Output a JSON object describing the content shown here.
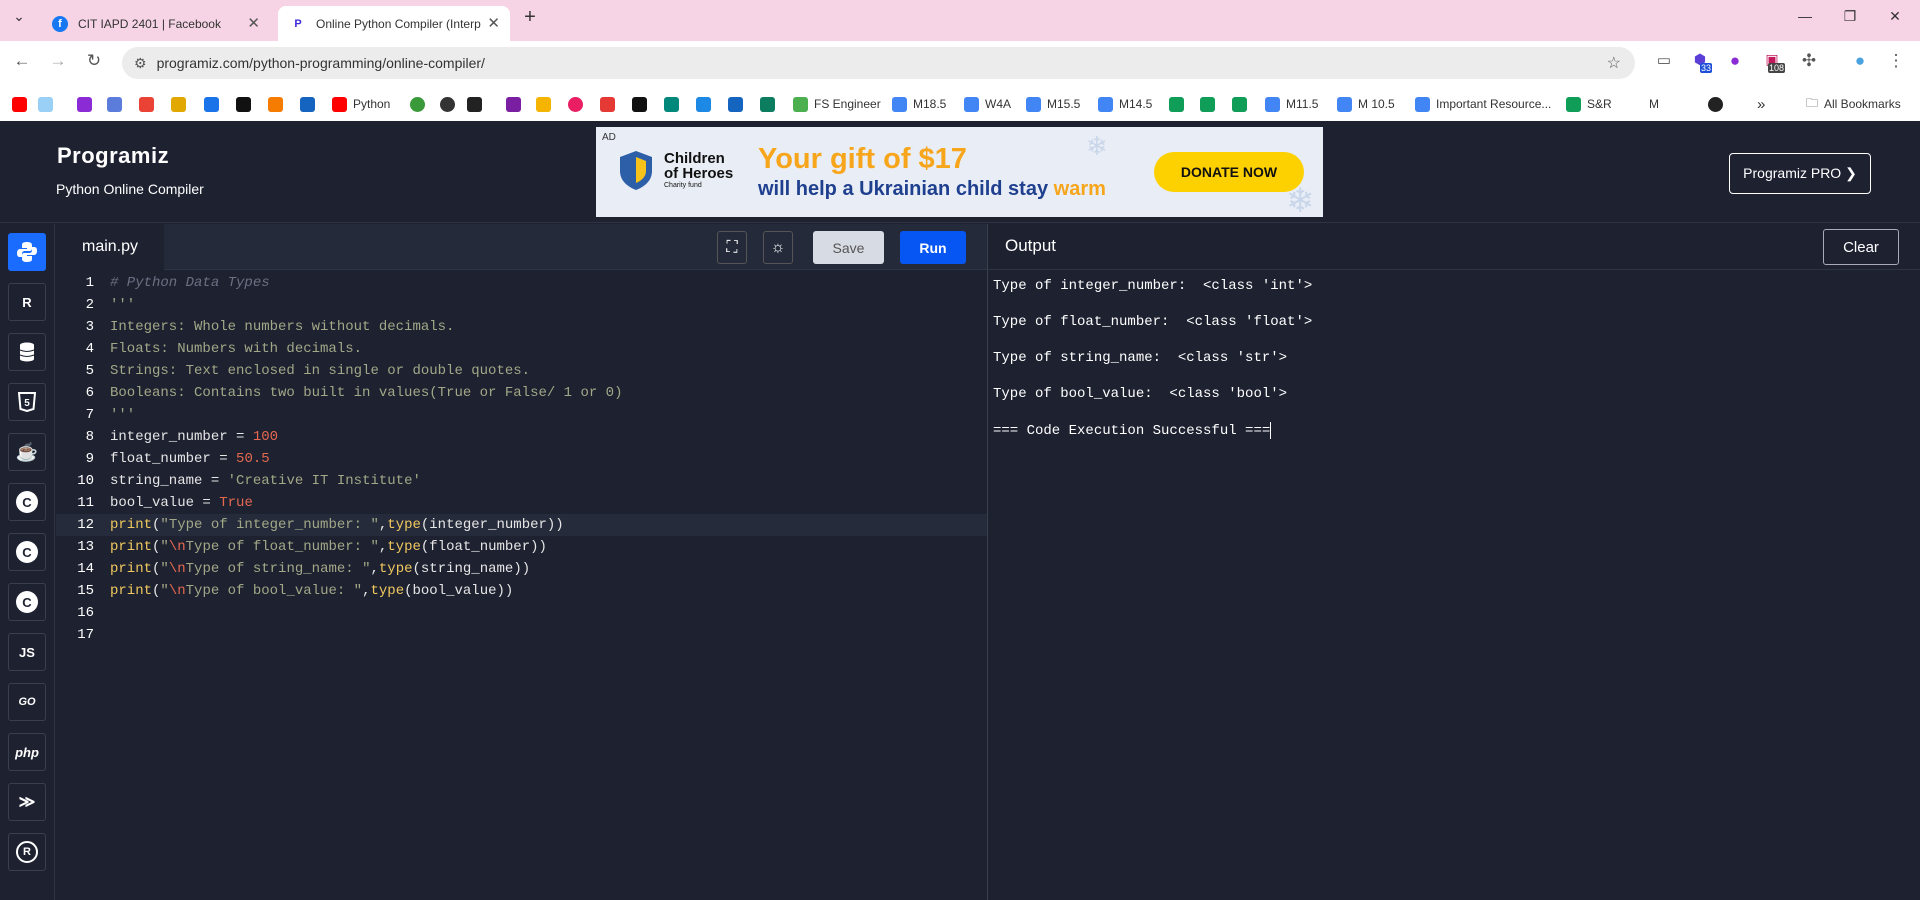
{
  "browser": {
    "tabs": [
      {
        "title": "CIT IAPD 2401 | Facebook"
      },
      {
        "title": "Online Python Compiler (Interp"
      }
    ],
    "new_tab": "+",
    "url": "programiz.com/python-programming/online-compiler/",
    "badges": {
      "ext1": "33",
      "ext2": "108"
    },
    "bookmarks": [
      "Python",
      "FS Engineer",
      "M18.5",
      "W4A",
      "M15.5",
      "M14.5",
      "M11.5",
      "M 10.5",
      "Important Resource...",
      "S&R",
      "M",
      "»",
      "All Bookmarks"
    ]
  },
  "header": {
    "logo": "Programiz",
    "subtitle": "Python Online Compiler",
    "pro_button": "Programiz PRO ❯"
  },
  "ad": {
    "tag": "AD",
    "org_line1": "Children",
    "org_line2": "of Heroes",
    "org_line3": "Charity fund",
    "headline": "Your gift of $17",
    "subline_main": "will help a Ukrainian child stay ",
    "subline_accent": "warm",
    "cta": "DONATE NOW"
  },
  "sidebar": {
    "items": [
      {
        "icon": "python-icon",
        "label": "",
        "active": true
      },
      {
        "icon": "r-language-icon",
        "label": "R"
      },
      {
        "icon": "database-icon",
        "label": ""
      },
      {
        "icon": "html5-icon",
        "label": "5"
      },
      {
        "icon": "java-icon",
        "label": "☕"
      },
      {
        "icon": "c-icon",
        "label": "C"
      },
      {
        "icon": "cpp-icon",
        "label": "C"
      },
      {
        "icon": "csharp-icon",
        "label": "C"
      },
      {
        "icon": "javascript-icon",
        "label": "JS"
      },
      {
        "icon": "go-icon",
        "label": "GO"
      },
      {
        "icon": "php-icon",
        "label": "php"
      },
      {
        "icon": "swift-icon",
        "label": "≫"
      },
      {
        "icon": "rust-icon",
        "label": "R"
      }
    ]
  },
  "editor": {
    "filename": "main.py",
    "save_label": "Save",
    "run_label": "Run",
    "lines": [
      {
        "n": "1",
        "parts": [
          {
            "t": "# Python Data Types",
            "c": "cmt"
          }
        ]
      },
      {
        "n": "2",
        "parts": [
          {
            "t": "'''",
            "c": "doc"
          }
        ]
      },
      {
        "n": "3",
        "parts": [
          {
            "t": "Integers: Whole numbers without decimals.",
            "c": "doc"
          }
        ]
      },
      {
        "n": "4",
        "parts": [
          {
            "t": "Floats: Numbers with decimals.",
            "c": "doc"
          }
        ]
      },
      {
        "n": "5",
        "parts": [
          {
            "t": "Strings: Text enclosed in single or double quotes.",
            "c": "doc"
          }
        ]
      },
      {
        "n": "6",
        "parts": [
          {
            "t": "Booleans: Contains two built in values(True or False/ 1 or 0)",
            "c": "doc"
          }
        ]
      },
      {
        "n": "7",
        "parts": [
          {
            "t": "'''",
            "c": "doc"
          }
        ]
      },
      {
        "n": "8",
        "parts": [
          {
            "t": "integer_number",
            "c": "id"
          },
          {
            "t": " = ",
            "c": "op"
          },
          {
            "t": "100",
            "c": "num"
          }
        ]
      },
      {
        "n": "9",
        "parts": [
          {
            "t": "float_number",
            "c": "id"
          },
          {
            "t": " = ",
            "c": "op"
          },
          {
            "t": "50.5",
            "c": "num"
          }
        ]
      },
      {
        "n": "10",
        "parts": [
          {
            "t": "string_name",
            "c": "id"
          },
          {
            "t": " = ",
            "c": "op"
          },
          {
            "t": "'Creative IT Institute'",
            "c": "str"
          }
        ]
      },
      {
        "n": "11",
        "parts": [
          {
            "t": "bool_value",
            "c": "id"
          },
          {
            "t": " = ",
            "c": "op"
          },
          {
            "t": "True",
            "c": "num"
          }
        ]
      },
      {
        "n": "12",
        "current": true,
        "parts": [
          {
            "t": "print",
            "c": "fn"
          },
          {
            "t": "(",
            "c": "id"
          },
          {
            "t": "\"Type of integer_number: \"",
            "c": "str"
          },
          {
            "t": ",",
            "c": "id"
          },
          {
            "t": "type",
            "c": "fn"
          },
          {
            "t": "(integer_number))",
            "c": "id"
          }
        ]
      },
      {
        "n": "13",
        "parts": [
          {
            "t": "print",
            "c": "fn"
          },
          {
            "t": "(",
            "c": "id"
          },
          {
            "t": "\"",
            "c": "str"
          },
          {
            "t": "\\n",
            "c": "esc"
          },
          {
            "t": "Type of float_number: \"",
            "c": "str"
          },
          {
            "t": ",",
            "c": "id"
          },
          {
            "t": "type",
            "c": "fn"
          },
          {
            "t": "(float_number))",
            "c": "id"
          }
        ]
      },
      {
        "n": "14",
        "parts": [
          {
            "t": "print",
            "c": "fn"
          },
          {
            "t": "(",
            "c": "id"
          },
          {
            "t": "\"",
            "c": "str"
          },
          {
            "t": "\\n",
            "c": "esc"
          },
          {
            "t": "Type of string_name: \"",
            "c": "str"
          },
          {
            "t": ",",
            "c": "id"
          },
          {
            "t": "type",
            "c": "fn"
          },
          {
            "t": "(string_name))",
            "c": "id"
          }
        ]
      },
      {
        "n": "15",
        "parts": [
          {
            "t": "print",
            "c": "fn"
          },
          {
            "t": "(",
            "c": "id"
          },
          {
            "t": "\"",
            "c": "str"
          },
          {
            "t": "\\n",
            "c": "esc"
          },
          {
            "t": "Type of bool_value: \"",
            "c": "str"
          },
          {
            "t": ",",
            "c": "id"
          },
          {
            "t": "type",
            "c": "fn"
          },
          {
            "t": "(bool_value))",
            "c": "id"
          }
        ]
      },
      {
        "n": "16",
        "parts": []
      },
      {
        "n": "17",
        "parts": []
      }
    ]
  },
  "output": {
    "title": "Output",
    "clear_label": "Clear",
    "lines": [
      "Type of integer_number:  <class 'int'>",
      "",
      "Type of float_number:  <class 'float'>",
      "",
      "Type of string_name:  <class 'str'>",
      "",
      "Type of bool_value:  <class 'bool'>",
      "",
      "=== Code Execution Successful ==="
    ]
  },
  "colors": {
    "bg": "#1d2130",
    "run_button": "#0556f3",
    "save_button": "#d7dbe3",
    "comment": "#6b7083",
    "docstring": "#a2a887",
    "number": "#e5684f",
    "string": "#a2a887",
    "function": "#f1c95f",
    "escape": "#e5684f",
    "identifier": "#e6e6e6",
    "donate": "#fdd100",
    "ad_headline": "#f7a51b",
    "ad_blue": "#1f3f8f"
  }
}
